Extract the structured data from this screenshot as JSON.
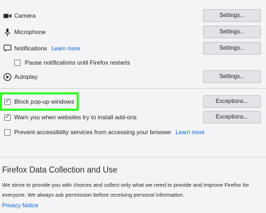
{
  "permissions": {
    "camera": {
      "label": "Camera",
      "button": "Settings..."
    },
    "microphone": {
      "label": "Microphone",
      "button": "Settings..."
    },
    "notifications": {
      "label": "Notifications",
      "learn_more": "Learn more",
      "button": "Settings..."
    },
    "pause_notifications": {
      "label": "Pause notifications until Firefox restarts",
      "checked": false
    },
    "autoplay": {
      "label": "Autoplay",
      "button": "Settings..."
    },
    "block_popups": {
      "label": "Block pop-up windows",
      "checked": true,
      "button": "Exceptions..."
    },
    "warn_addons": {
      "label": "Warn you when websites try to install add-ons",
      "checked": true,
      "button": "Exceptions..."
    },
    "prevent_accessibility": {
      "label": "Prevent accessibility services from accessing your browser",
      "learn_more": "Learn more",
      "checked": false
    }
  },
  "data_collection": {
    "title": "Firefox Data Collection and Use",
    "text": "We strive to provide you with choices and collect only what we need to provide and improve Firefox for everyone. We always ask permission before receiving personal information.",
    "privacy_link": "Privacy Notice"
  },
  "colors": {
    "accent_link": "#0a63d6",
    "highlight": "#33ff22"
  }
}
